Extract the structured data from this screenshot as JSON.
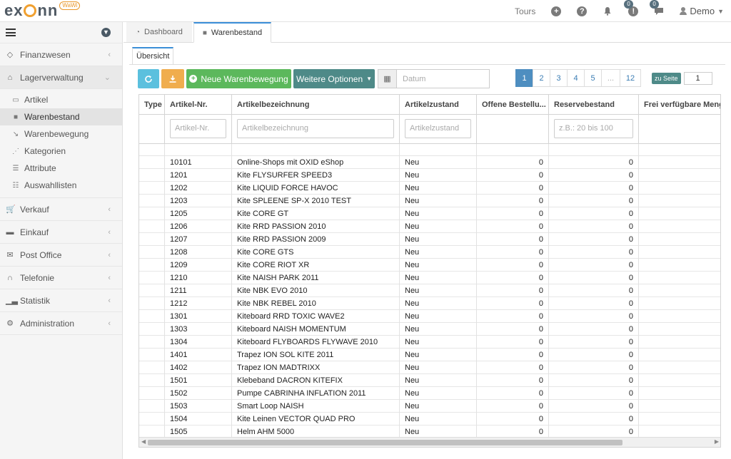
{
  "app": {
    "logo_text_left": "ex",
    "logo_text_right": "nn",
    "logo_badge": "WaWi"
  },
  "topnav": {
    "tours": "Tours",
    "notif_count_1": "0",
    "notif_count_2": "0",
    "user_name": "Demo"
  },
  "sidebar": {
    "items": [
      {
        "label": "Finanzwesen",
        "icon": "tag-icon"
      },
      {
        "label": "Lagerverwaltung",
        "icon": "warehouse-icon"
      },
      {
        "label": "Verkauf",
        "icon": "cart-icon"
      },
      {
        "label": "Einkauf",
        "icon": "truck-icon"
      },
      {
        "label": "Post Office",
        "icon": "envelope-icon"
      },
      {
        "label": "Telefonie",
        "icon": "headset-icon"
      },
      {
        "label": "Statistik",
        "icon": "chart-icon"
      },
      {
        "label": "Administration",
        "icon": "cogs-icon"
      }
    ],
    "subitems": [
      {
        "label": "Artikel"
      },
      {
        "label": "Warenbestand"
      },
      {
        "label": "Warenbewegung"
      },
      {
        "label": "Kategorien"
      },
      {
        "label": "Attribute"
      },
      {
        "label": "Auswahllisten"
      }
    ]
  },
  "tabs": [
    {
      "label": "Dashboard"
    },
    {
      "label": "Warenbestand"
    }
  ],
  "subtab": "Übersicht",
  "toolbar": {
    "new_movement": "Neue Warenbewegung",
    "more_options": "Weitere Optionen",
    "date_placeholder": "Datum"
  },
  "pagination": {
    "pages": [
      "1",
      "2",
      "3",
      "4",
      "5",
      "...",
      "12"
    ],
    "current": "1",
    "goto_label": "zu Seite",
    "goto_value": "1"
  },
  "grid": {
    "columns": [
      "Type",
      "Artikel-Nr.",
      "Artikelbezeichnung",
      "Artikelzustand",
      "Offene Bestellu...",
      "Reservebestand",
      "Frei verfügbare Menge"
    ],
    "filters": {
      "artikel_nr": "Artikel-Nr.",
      "bezeichnung": "Artikelbezeichnung",
      "zustand": "Artikelzustand",
      "reserve": "z.B.: 20 bis 100"
    },
    "rows": [
      {
        "nr": "10101",
        "name": "Online-Shops mit OXID eShop",
        "state": "Neu",
        "open": "0",
        "reserve": "0"
      },
      {
        "nr": "1201",
        "name": "Kite FLYSURFER SPEED3",
        "state": "Neu",
        "open": "0",
        "reserve": "0"
      },
      {
        "nr": "1202",
        "name": "Kite LIQUID FORCE HAVOC",
        "state": "Neu",
        "open": "0",
        "reserve": "0"
      },
      {
        "nr": "1203",
        "name": "Kite SPLEENE SP-X 2010 TEST",
        "state": "Neu",
        "open": "0",
        "reserve": "0"
      },
      {
        "nr": "1205",
        "name": "Kite CORE GT",
        "state": "Neu",
        "open": "0",
        "reserve": "0"
      },
      {
        "nr": "1206",
        "name": "Kite RRD PASSION 2010",
        "state": "Neu",
        "open": "0",
        "reserve": "0"
      },
      {
        "nr": "1207",
        "name": "Kite RRD PASSION 2009",
        "state": "Neu",
        "open": "0",
        "reserve": "0"
      },
      {
        "nr": "1208",
        "name": "Kite CORE GTS",
        "state": "Neu",
        "open": "0",
        "reserve": "0"
      },
      {
        "nr": "1209",
        "name": "Kite CORE RIOT XR",
        "state": "Neu",
        "open": "0",
        "reserve": "0"
      },
      {
        "nr": "1210",
        "name": "Kite NAISH PARK 2011",
        "state": "Neu",
        "open": "0",
        "reserve": "0"
      },
      {
        "nr": "1211",
        "name": "Kite NBK EVO 2010",
        "state": "Neu",
        "open": "0",
        "reserve": "0"
      },
      {
        "nr": "1212",
        "name": "Kite NBK REBEL 2010",
        "state": "Neu",
        "open": "0",
        "reserve": "0"
      },
      {
        "nr": "1301",
        "name": "Kiteboard RRD TOXIC WAVE2",
        "state": "Neu",
        "open": "0",
        "reserve": "0"
      },
      {
        "nr": "1303",
        "name": "Kiteboard NAISH MOMENTUM",
        "state": "Neu",
        "open": "0",
        "reserve": "0"
      },
      {
        "nr": "1304",
        "name": "Kiteboard FLYBOARDS FLYWAVE 2010",
        "state": "Neu",
        "open": "0",
        "reserve": "0"
      },
      {
        "nr": "1401",
        "name": "Trapez ION SOL KITE 2011",
        "state": "Neu",
        "open": "0",
        "reserve": "0"
      },
      {
        "nr": "1402",
        "name": "Trapez ION MADTRIXX",
        "state": "Neu",
        "open": "0",
        "reserve": "0"
      },
      {
        "nr": "1501",
        "name": "Klebeband DACRON KITEFIX",
        "state": "Neu",
        "open": "0",
        "reserve": "0"
      },
      {
        "nr": "1502",
        "name": "Pumpe CABRINHA INFLATION 2011",
        "state": "Neu",
        "open": "0",
        "reserve": "0"
      },
      {
        "nr": "1503",
        "name": "Smart Loop NAISH",
        "state": "Neu",
        "open": "0",
        "reserve": "0"
      },
      {
        "nr": "1504",
        "name": "Kite Leinen VECTOR QUAD PRO",
        "state": "Neu",
        "open": "0",
        "reserve": "0"
      },
      {
        "nr": "1505",
        "name": "Helm AHM 5000",
        "state": "Neu",
        "open": "0",
        "reserve": "0"
      }
    ]
  },
  "colors": {
    "accent": "#3b8fd8",
    "refresh": "#5bc0de",
    "download": "#f0ad4e",
    "new": "#5cb85c",
    "more": "#4e8a88"
  }
}
